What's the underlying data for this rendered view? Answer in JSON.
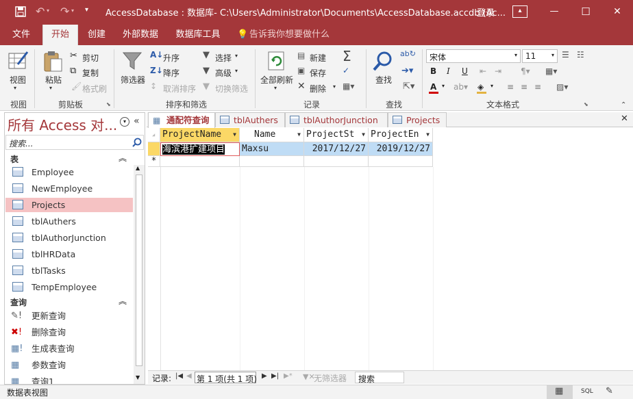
{
  "titlebar": {
    "title": "AccessDatabase : 数据库- C:\\Users\\Administrator\\Documents\\AccessDatabase.accdb (Ac...",
    "signin": "登录",
    "save_icon": "save-icon",
    "undo_icon": "undo-icon",
    "redo_icon": "redo-icon",
    "customize_icon": "customize-qat-icon",
    "minimize": "—",
    "restore": "☐",
    "close": "✕",
    "help": "?"
  },
  "menu": {
    "tabs": [
      "文件",
      "开始",
      "创建",
      "外部数据",
      "数据库工具"
    ],
    "tellme": "告诉我你想要做什么"
  },
  "ribbon": {
    "view": {
      "label": "视图",
      "group": "视图"
    },
    "clipboard": {
      "paste": "粘贴",
      "cut": "剪切",
      "copy": "复制",
      "format_painter": "格式刷",
      "group": "剪贴板"
    },
    "sortfilter": {
      "filter": "筛选器",
      "asc": "升序",
      "desc": "降序",
      "remove_sort": "取消排序",
      "selection": "选择",
      "advanced": "高级",
      "toggle_filter": "切换筛选",
      "group": "排序和筛选"
    },
    "records": {
      "refresh_all": "全部刷新",
      "new": "新建",
      "save": "保存",
      "delete": "删除",
      "group": "记录"
    },
    "find": {
      "find": "查找",
      "group": "查找"
    },
    "textformat": {
      "font": "宋体",
      "size": "11",
      "bold": "B",
      "italic": "I",
      "underline": "U",
      "group": "文本格式"
    }
  },
  "nav": {
    "title": "所有 Access 对...",
    "search_placeholder": "搜索...",
    "tables_header": "表",
    "tables": [
      "Employee",
      "NewEmployee",
      "Projects",
      "tblAuthers",
      "tblAuthorJunction",
      "tblHRData",
      "tblTasks",
      "TempEmployee"
    ],
    "selected_table": "Projects",
    "queries_header": "查询",
    "queries": [
      "更新查询",
      "删除查询",
      "生成表查询",
      "参数查询",
      "查询1"
    ]
  },
  "doc_tabs": [
    "通配符查询",
    "tblAuthers",
    "tblAuthorJunction",
    "Projects"
  ],
  "active_doc_tab": "通配符查询",
  "datasheet": {
    "columns": [
      "ProjectName",
      "Name",
      "ProjectSt",
      "ProjectEn"
    ],
    "rows": [
      [
        "海滨港扩建项目",
        "Maxsu",
        "2017/12/27",
        "2019/12/27"
      ]
    ],
    "new_row_marker": "*"
  },
  "record_nav": {
    "label": "记录:",
    "position": "第 1 项(共 1 项)",
    "filter": "无筛选器",
    "search": "搜索"
  },
  "status": {
    "text": "数据表视图",
    "sql": "SQL"
  },
  "colors": {
    "accent": "#a4373a",
    "selected_nav": "#f5c2c3",
    "row_highlight": "#bfdcf5",
    "header_active": "#fbd866"
  }
}
